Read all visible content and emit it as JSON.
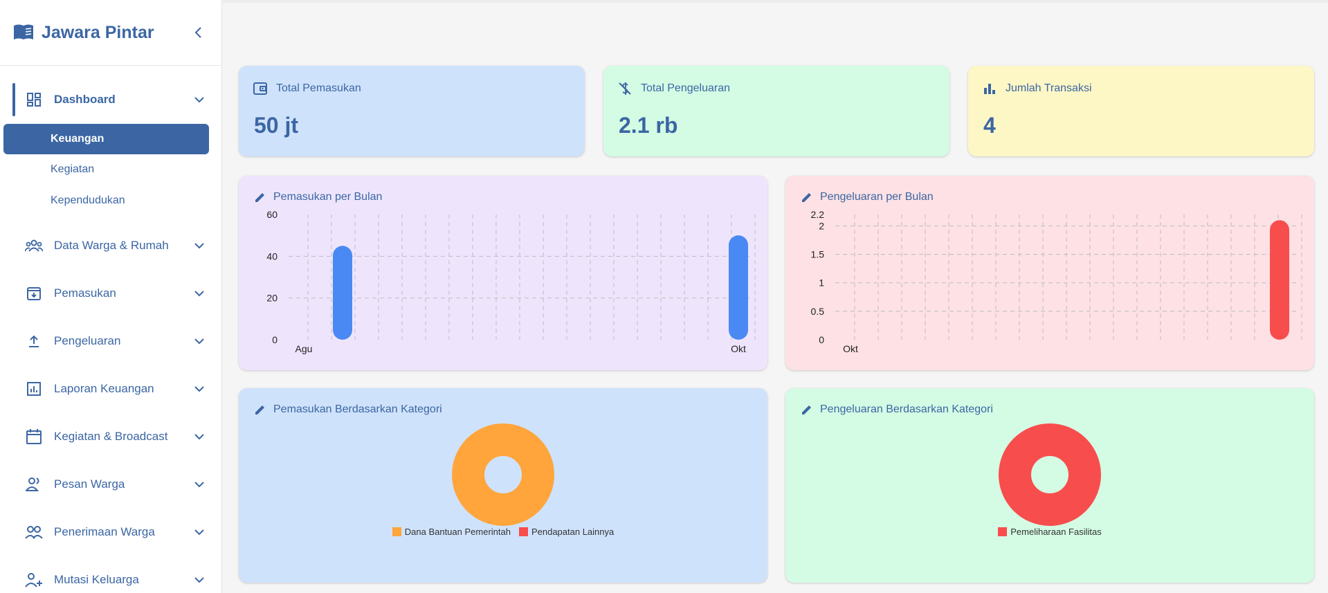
{
  "app": {
    "title": "Jawara Pintar"
  },
  "sidebar": {
    "items": [
      {
        "label": "Dashboard",
        "icon": "dashboard-icon"
      },
      {
        "label": "Data Warga & Rumah",
        "icon": "people-group-icon"
      },
      {
        "label": "Pemasukan",
        "icon": "income-box-icon"
      },
      {
        "label": "Pengeluaran",
        "icon": "upload-icon"
      },
      {
        "label": "Laporan Keuangan",
        "icon": "report-chart-icon"
      },
      {
        "label": "Kegiatan & Broadcast",
        "icon": "calendar-icon"
      },
      {
        "label": "Pesan Warga",
        "icon": "people-message-icon"
      },
      {
        "label": "Penerimaan Warga",
        "icon": "people-accept-icon"
      },
      {
        "label": "Mutasi Keluarga",
        "icon": "person-add-icon"
      }
    ],
    "sub_items": [
      {
        "label": "Keuangan"
      },
      {
        "label": "Kegiatan"
      },
      {
        "label": "Kependudukan"
      }
    ]
  },
  "stats": [
    {
      "title": "Total Pemasukan",
      "value": "50 jt",
      "icon": "wallet-icon",
      "bg": "#cfe2fb"
    },
    {
      "title": "Total Pengeluaran",
      "value": "2.1 rb",
      "icon": "money-off-icon",
      "bg": "#d4fbe4"
    },
    {
      "title": "Jumlah Transaksi",
      "value": "4",
      "icon": "bar-chart-icon",
      "bg": "#fdf7c6"
    }
  ],
  "charts": {
    "income_bar": {
      "title": "Pemasukan per Bulan"
    },
    "expense_bar": {
      "title": "Pengeluaran per Bulan"
    },
    "income_pie": {
      "title": "Pemasukan Berdasarkan Kategori"
    },
    "expense_pie": {
      "title": "Pengeluaran Berdasarkan Kategori"
    }
  },
  "chart_data": [
    {
      "type": "bar",
      "title": "Pemasukan per Bulan",
      "categories": [
        "Agu",
        "Okt"
      ],
      "values": [
        45,
        50
      ],
      "ylim": [
        0,
        60
      ],
      "yticks": [
        0,
        20,
        40,
        60
      ],
      "grid": true,
      "color": "#4a89f3"
    },
    {
      "type": "bar",
      "title": "Pengeluaran per Bulan",
      "categories": [
        "Okt"
      ],
      "values": [
        2.1
      ],
      "ylim": [
        0,
        2.2
      ],
      "yticks": [
        0,
        0.5,
        1,
        1.5,
        2,
        2.2
      ],
      "grid": true,
      "color": "#f84d4d"
    },
    {
      "type": "pie",
      "title": "Pemasukan Berdasarkan Kategori",
      "labels": [
        "Dana Bantuan Pemerintah",
        "Pendapatan Lainnya"
      ],
      "values": [
        100,
        0
      ],
      "colors": [
        "#ffa53c",
        "#f84d4d"
      ],
      "legend": "bottom"
    },
    {
      "type": "pie",
      "title": "Pengeluaran Berdasarkan Kategori",
      "labels": [
        "Pemeliharaan Fasilitas"
      ],
      "values": [
        100
      ],
      "colors": [
        "#f84d4d"
      ],
      "legend": "bottom"
    }
  ]
}
